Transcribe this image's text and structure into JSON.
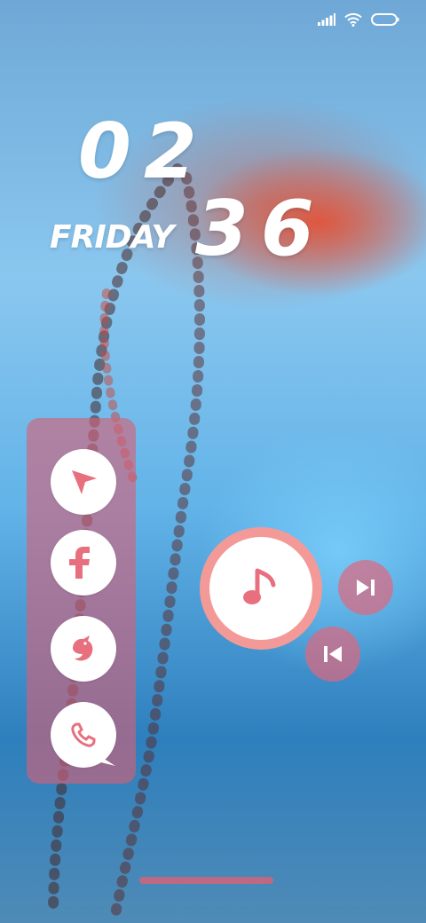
{
  "lock_screen": {
    "time_hour": "02",
    "time_minute": "36",
    "weekday": "FRIDAY"
  },
  "status_bar": {
    "icons": [
      "signal-icon",
      "wifi-icon",
      "battery-icon"
    ]
  },
  "app_dock": {
    "apps": [
      {
        "name": "navigation-app",
        "icon": "navigation-arrow-icon"
      },
      {
        "name": "facebook-app",
        "icon": "facebook-icon"
      },
      {
        "name": "bird-app",
        "icon": "bird-icon"
      },
      {
        "name": "phone-app",
        "icon": "phone-chat-icon"
      }
    ]
  },
  "media_controls": {
    "buttons": [
      "music-note-icon",
      "skip-next-icon",
      "skip-previous-icon"
    ]
  },
  "colors": {
    "accent_pink": "#de6880",
    "music_ring": "#f39a98",
    "icon_fill": "#e8707e",
    "text": "#ffffff"
  }
}
